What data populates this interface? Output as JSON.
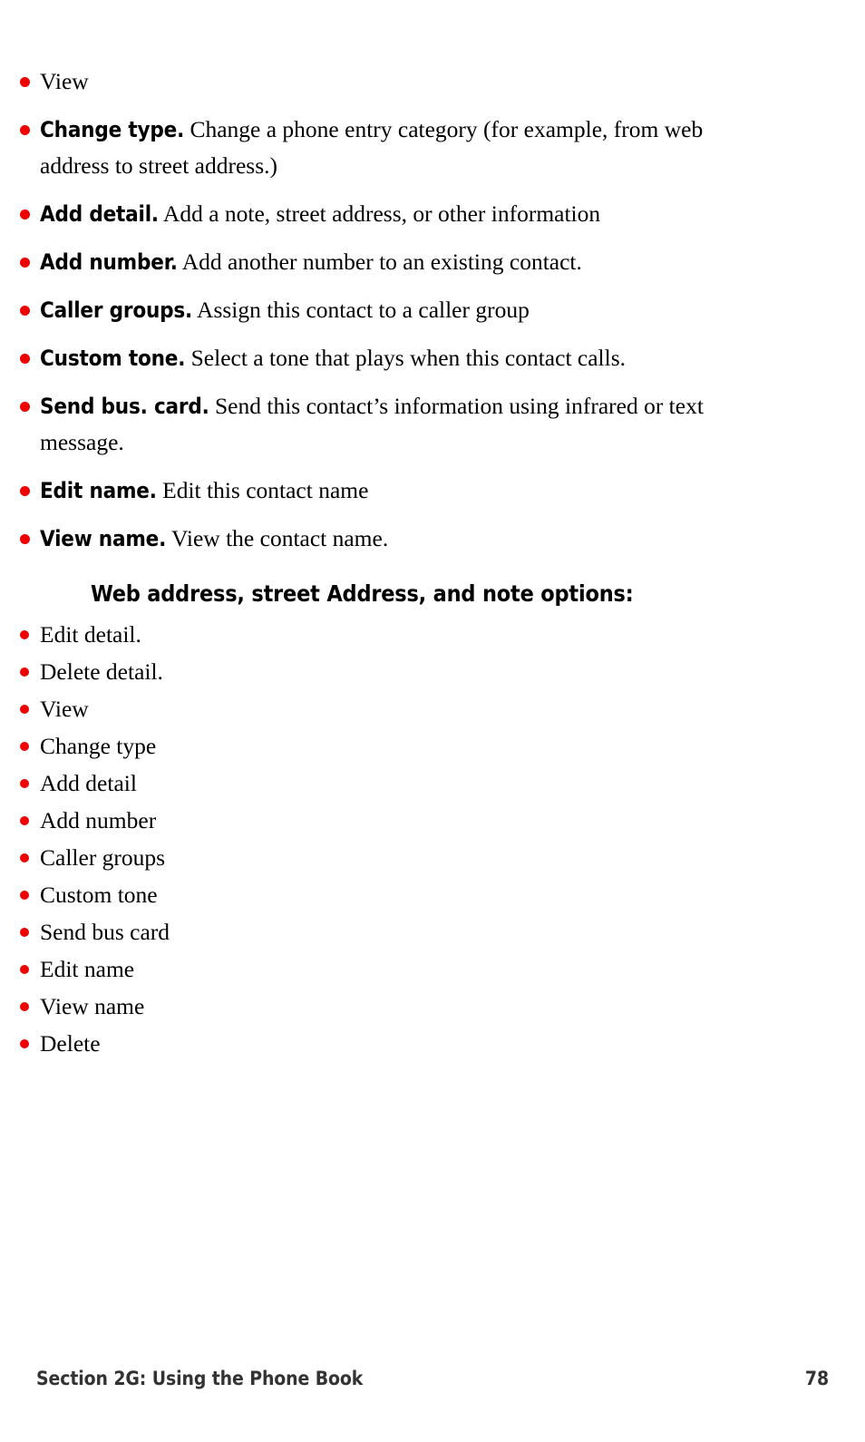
{
  "colors": {
    "bullet": "#ee0000",
    "text": "#000000",
    "footer_text": "#333333",
    "page_background": "#ffffff"
  },
  "contact_options_list": [
    {
      "term": "",
      "desc": "View"
    },
    {
      "term": "Change type.",
      "desc": "Change a phone entry category (for example, from web address to street address.)"
    },
    {
      "term": "Add detail.",
      "desc": "Add a note, street address, or other information"
    },
    {
      "term": "Add number.",
      "desc": "Add another number to an existing contact."
    },
    {
      "term": "Caller groups.",
      "desc": "Assign this contact to a caller group"
    },
    {
      "term": "Custom tone.",
      "desc": "Select a tone that plays when this contact calls."
    },
    {
      "term": "Send bus. card.",
      "desc": "Send this contact’s information using infrared or text message."
    },
    {
      "term": "Edit name.",
      "desc": "Edit this contact name"
    },
    {
      "term": "View name.",
      "desc": "View the contact name."
    }
  ],
  "section": {
    "heading": "Web address, street Address, and note options:",
    "items": [
      "Edit detail.",
      "Delete detail.",
      "View",
      "Change type",
      "Add detail",
      "Add number",
      "Caller groups",
      "Custom tone",
      "Send bus card",
      "Edit name",
      "View name",
      "Delete"
    ]
  },
  "footer": {
    "title": "Section 2G: Using the Phone Book",
    "page_number": "78"
  }
}
